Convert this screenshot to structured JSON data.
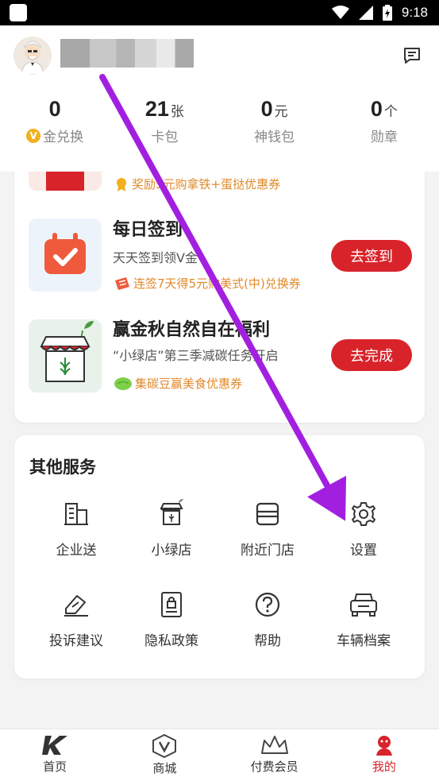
{
  "status_bar": {
    "time": "9:18"
  },
  "header": {
    "stats": [
      {
        "value": "0",
        "unit": "",
        "label": "金兑换",
        "badge": "V"
      },
      {
        "value": "21",
        "unit": "张",
        "label": "卡包"
      },
      {
        "value": "0",
        "unit": "元",
        "label": "神钱包"
      },
      {
        "value": "0",
        "unit": "个",
        "label": "勋章"
      }
    ]
  },
  "tasks": {
    "partial_reward": "奖励5元购拿铁+蛋挞优惠券",
    "items": [
      {
        "title": "每日签到",
        "subtitle": "天天签到领V金",
        "reward": "连签7天得5元购美式(中)兑换券",
        "button": "去签到"
      },
      {
        "title": "赢金秋自然自在福利",
        "subtitle": "“小绿店”第三季减碳任务开启",
        "reward": "集碳豆赢美食优惠券",
        "button": "去完成"
      }
    ]
  },
  "services": {
    "title": "其他服务",
    "items": [
      {
        "label": "企业送",
        "icon": "building-icon"
      },
      {
        "label": "小绿店",
        "icon": "green-store-icon"
      },
      {
        "label": "附近门店",
        "icon": "store-icon"
      },
      {
        "label": "设置",
        "icon": "gear-icon"
      },
      {
        "label": "投诉建议",
        "icon": "feedback-icon"
      },
      {
        "label": "隐私政策",
        "icon": "privacy-icon"
      },
      {
        "label": "帮助",
        "icon": "help-icon"
      },
      {
        "label": "车辆档案",
        "icon": "car-icon"
      }
    ]
  },
  "bottom_nav": {
    "items": [
      {
        "label": "首页",
        "icon": "kfc-k-icon"
      },
      {
        "label": "商城",
        "icon": "v-mall-icon"
      },
      {
        "label": "付费会员",
        "icon": "crown-icon"
      },
      {
        "label": "我的",
        "icon": "colonel-icon"
      }
    ]
  },
  "colors": {
    "accent": "#d8232a",
    "reward": "#e0892a",
    "arrow": "#a31fe0"
  }
}
